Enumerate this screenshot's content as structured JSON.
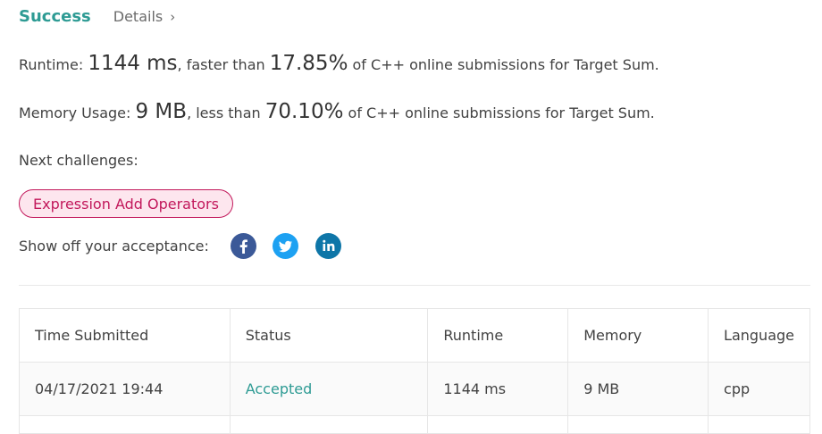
{
  "header": {
    "status": "Success",
    "details_label": "Details",
    "chevron": "›"
  },
  "runtime": {
    "label": "Runtime: ",
    "value": "1144 ms",
    "faster_text": ", faster than ",
    "percent": "17.85%",
    "suffix": " of C++ online submissions for Target Sum."
  },
  "memory": {
    "label": "Memory Usage: ",
    "value": "9 MB",
    "less_text": ", less than ",
    "percent": "70.10%",
    "suffix": " of C++ online submissions for Target Sum."
  },
  "next_challenges": {
    "label": "Next challenges:",
    "items": [
      "Expression Add Operators"
    ]
  },
  "share": {
    "label": "Show off your acceptance:",
    "icons": [
      "facebook-icon",
      "twitter-icon",
      "linkedin-icon"
    ]
  },
  "table": {
    "headers": [
      "Time Submitted",
      "Status",
      "Runtime",
      "Memory",
      "Language"
    ],
    "rows": [
      [
        "04/17/2021 19:44",
        "Accepted",
        "1144 ms",
        "9 MB",
        "cpp"
      ]
    ]
  },
  "colors": {
    "accent": "#2e9b94",
    "tag_border": "#c2185b",
    "tag_bg": "#fde6ee",
    "facebook": "#3b5998",
    "twitter": "#1da1f2",
    "linkedin": "#0e76a8"
  }
}
